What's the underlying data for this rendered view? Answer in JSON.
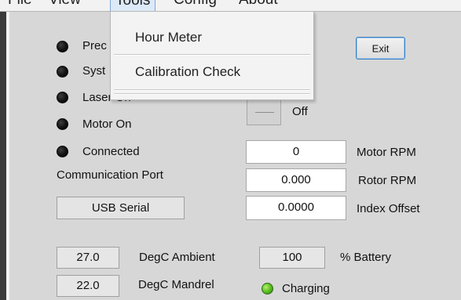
{
  "menu": {
    "file": "File",
    "view": "View",
    "tools": "Tools",
    "config": "Config",
    "about": "About"
  },
  "tools_menu": {
    "items": [
      "Hour Meter",
      "Calibration Check"
    ]
  },
  "status": {
    "items": [
      {
        "label": "Prec",
        "state": "off"
      },
      {
        "label": "Syst",
        "state": "off"
      },
      {
        "label": "Laser On",
        "state": "off"
      },
      {
        "label": "Motor On",
        "state": "off"
      },
      {
        "label": "Connected",
        "state": "off"
      }
    ],
    "led_off_color": "#111111",
    "led_on_color": "#5bbf20"
  },
  "buttons": {
    "exit": "Exit"
  },
  "toggle": {
    "label": "Off"
  },
  "communication": {
    "label": "Communication Port",
    "value": "USB Serial"
  },
  "readings": {
    "motor_rpm": {
      "value": "0",
      "label": "Motor RPM"
    },
    "rotor_rpm": {
      "value": "0.000",
      "label": "Rotor RPM"
    },
    "index_offset": {
      "value": "0.0000",
      "label": "Index Offset"
    }
  },
  "temperatures": {
    "ambient": {
      "value": "27.0",
      "label": "DegC Ambient"
    },
    "mandrel": {
      "value": "22.0",
      "label": "DegC Mandrel"
    }
  },
  "battery": {
    "value": "100",
    "label": "% Battery",
    "charging_label": "Charging",
    "charging_color": "#5bbf20"
  }
}
